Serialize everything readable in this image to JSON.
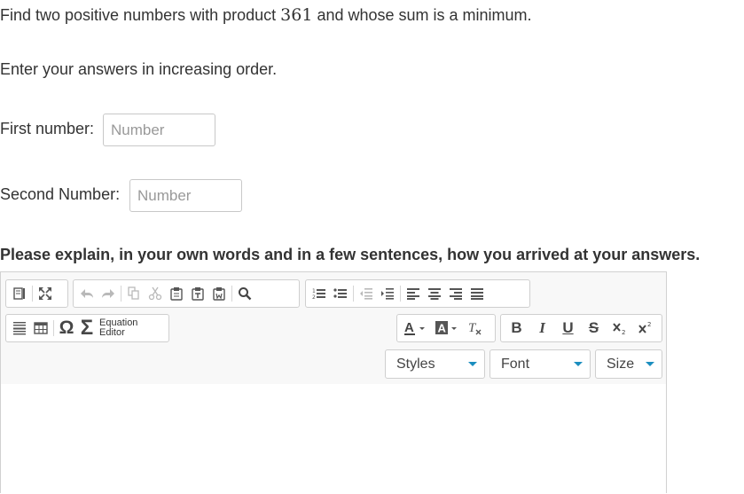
{
  "question": {
    "prefix": "Find two positive numbers with product",
    "product": "361",
    "suffix": "and whose sum is a minimum."
  },
  "instruction": "Enter your answers in increasing order.",
  "first": {
    "label": "First number:",
    "placeholder": "Number",
    "value": ""
  },
  "second": {
    "label": "Second Number:",
    "placeholder": "Number",
    "value": ""
  },
  "explain_prompt": "Please explain, in your own words and in a few sentences, how you arrived at your answers.",
  "editor": {
    "equation_line1": "Equation",
    "equation_line2": "Editor",
    "omega": "Ω",
    "sigma": "Σ",
    "bold": "B",
    "italic": "I",
    "underline": "U",
    "strike": "S",
    "styles": "Styles",
    "font": "Font",
    "size": "Size",
    "content": ""
  }
}
